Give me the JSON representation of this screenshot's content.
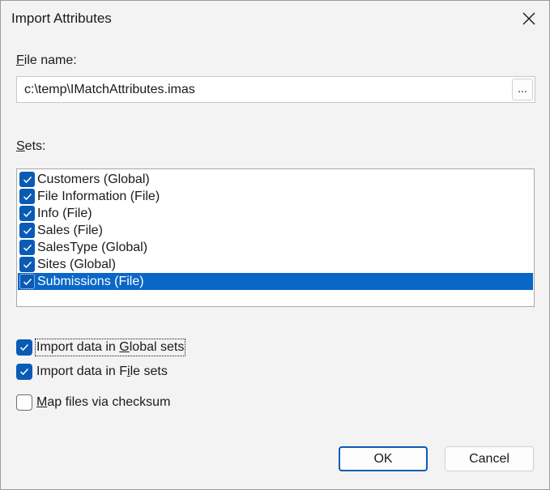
{
  "window": {
    "title": "Import Attributes"
  },
  "file_name": {
    "label_prefix": "",
    "label_accel": "F",
    "label_rest": "ile name:",
    "value": "c:\\temp\\IMatchAttributes.imas",
    "browse_label": "..."
  },
  "sets": {
    "label_accel": "S",
    "label_rest": "ets:",
    "items": [
      {
        "label": "Customers (Global)",
        "checked": true,
        "selected": false
      },
      {
        "label": "File Information (File)",
        "checked": true,
        "selected": false
      },
      {
        "label": "Info (File)",
        "checked": true,
        "selected": false
      },
      {
        "label": "Sales (File)",
        "checked": true,
        "selected": false
      },
      {
        "label": "SalesType (Global)",
        "checked": true,
        "selected": false
      },
      {
        "label": "Sites (Global)",
        "checked": true,
        "selected": false
      },
      {
        "label": "Submissions (File)",
        "checked": true,
        "selected": true
      }
    ]
  },
  "options": {
    "global": {
      "pre": "Import data in ",
      "accel": "G",
      "post": "lobal sets",
      "checked": true
    },
    "file": {
      "pre": "Import data in F",
      "accel": "i",
      "post": "le sets",
      "checked": true
    },
    "checksum": {
      "pre": "",
      "accel": "M",
      "post": "ap files via checksum",
      "checked": false
    }
  },
  "buttons": {
    "ok": "OK",
    "cancel": "Cancel"
  },
  "colors": {
    "accent": "#0a5bb6",
    "selection": "#0a67c7"
  }
}
